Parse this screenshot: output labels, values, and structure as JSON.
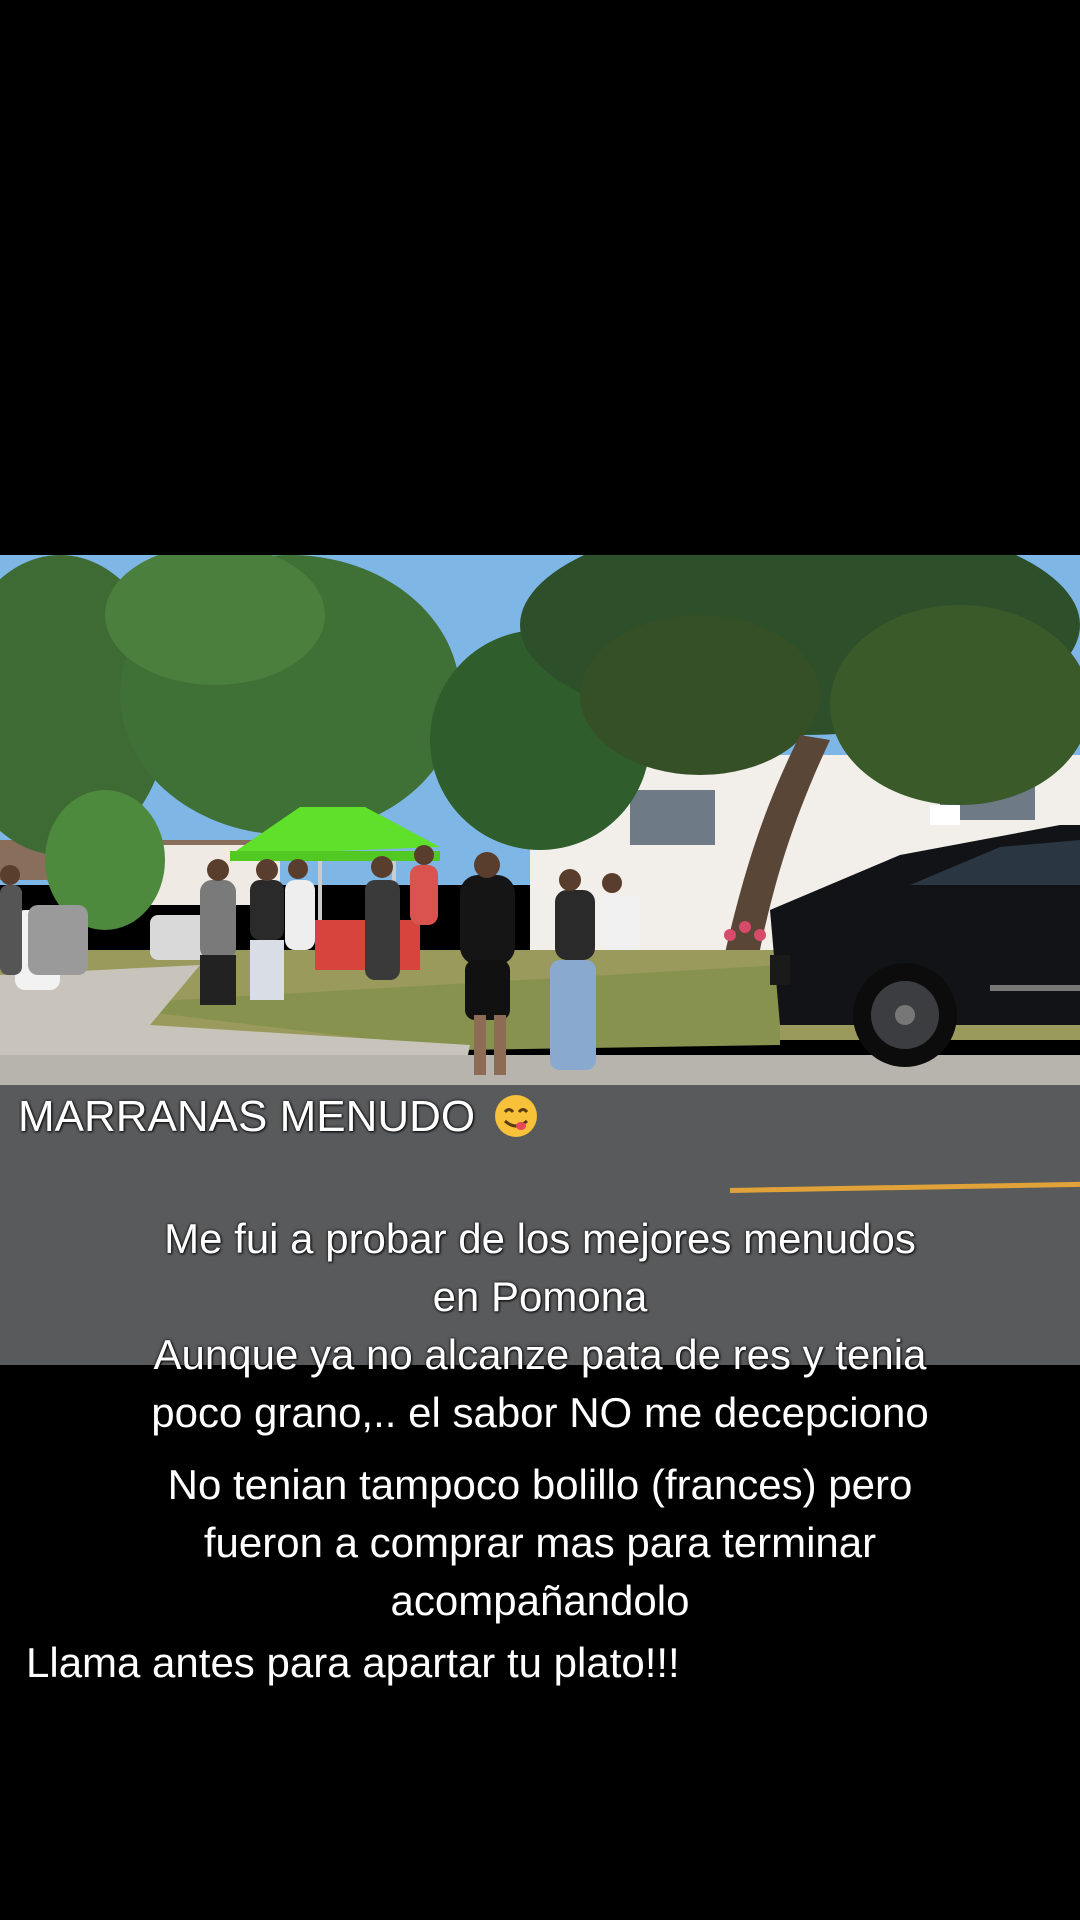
{
  "video": {
    "scene_description_icon": "street-photo"
  },
  "caption": {
    "title": "MARRANAS MENUDO",
    "title_emoji": "yum-face-emoji",
    "lines": [
      "Me fui a probar de los mejores menudos",
      "en Pomona",
      "Aunque ya no alcanze pata de res y tenia",
      "poco grano,.. el sabor NO me decepciono",
      "No tenian tampoco bolillo (frances) pero",
      "fueron a comprar mas para terminar",
      "acompañandolo",
      "Llama antes para apartar tu plato!!!"
    ]
  },
  "colors": {
    "background": "#000000",
    "canopy": "#5fe02a",
    "sky": "#7eb6e6"
  }
}
